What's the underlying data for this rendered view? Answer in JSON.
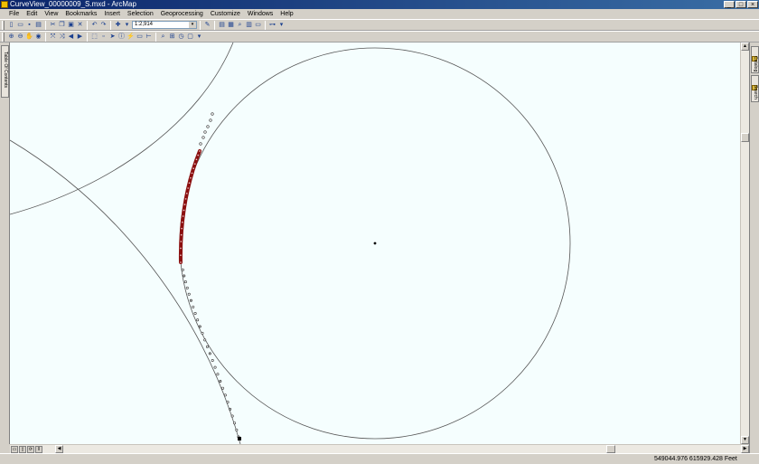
{
  "window": {
    "title": "CurveView_00000009_S.mxd - ArcMap",
    "controls": [
      "_",
      "□",
      "×"
    ]
  },
  "menu": {
    "items": [
      "File",
      "Edit",
      "View",
      "Bookmarks",
      "Insert",
      "Selection",
      "Geoprocessing",
      "Customize",
      "Windows",
      "Help"
    ]
  },
  "toolbar": {
    "scale_value": "1:2,914",
    "dropdown_arrow": "▾"
  },
  "panels": {
    "left_tab": "Table Of Contents",
    "right_tab_catalog": "Catalog",
    "right_tab_search": "Search"
  },
  "statusbar": {
    "coordinates": "549044.976  615929.428 Feet"
  },
  "icons": {
    "tb1": [
      "new-document-icon",
      "open-folder-icon",
      "save-icon",
      "print-icon",
      "cut-icon",
      "copy-icon",
      "paste-icon",
      "delete-icon",
      "undo-icon",
      "redo-icon",
      "add-data-icon",
      "editor-toolbar-icon",
      "table-of-contents-icon",
      "catalog-window-icon",
      "search-window-icon",
      "arctoolbox-icon",
      "python-window-icon",
      "model-builder-icon"
    ],
    "tb2": [
      "zoom-in-icon",
      "zoom-out-icon",
      "pan-icon",
      "full-extent-icon",
      "fixed-zoom-in-icon",
      "fixed-zoom-out-icon",
      "back-extent-icon",
      "forward-extent-icon",
      "select-features-icon",
      "clear-selection-icon",
      "select-elements-icon",
      "identify-icon",
      "hyperlink-icon",
      "html-popup-icon",
      "measure-icon",
      "find-icon",
      "go-to-xy-icon",
      "time-slider-icon",
      "viewer-window-icon"
    ]
  },
  "colors": {
    "map_background": "#f5fefe",
    "selected_features": "#8b1010",
    "curve_line": "#555555",
    "title_bar": "#0a246a"
  }
}
